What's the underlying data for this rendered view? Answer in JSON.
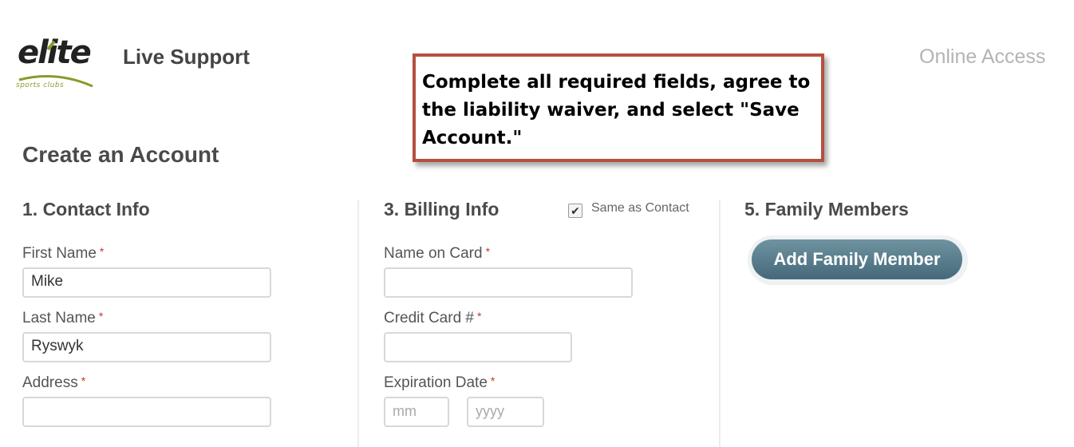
{
  "header": {
    "logo_word": "elite",
    "logo_sub": "sports clubs",
    "live_support": "Live Support",
    "online_access": "Online Access"
  },
  "callout": {
    "text": "Complete all required fields, agree to the liability waiver, and select \"Save Account.\""
  },
  "page_title": "Create an Account",
  "contact": {
    "title": "1. Contact Info",
    "first_name_label": "First Name",
    "first_name_value": "Mike",
    "last_name_label": "Last Name",
    "last_name_value": "Ryswyk",
    "address_label": "Address",
    "address_value": ""
  },
  "billing": {
    "title": "3. Billing Info",
    "same_as_contact_label": "Same as Contact",
    "same_as_contact_checked": true,
    "checkmark": "✔",
    "name_on_card_label": "Name on Card",
    "credit_card_label": "Credit Card #",
    "expiration_label": "Expiration Date",
    "exp_month_placeholder": "mm",
    "exp_year_placeholder": "yyyy"
  },
  "family": {
    "title": "5. Family Members",
    "add_button_label": "Add Family Member"
  },
  "required_marker": "*",
  "colors": {
    "callout_border": "#b5503f",
    "button": "#557a8a",
    "logo_accent": "#8a9a2a"
  }
}
